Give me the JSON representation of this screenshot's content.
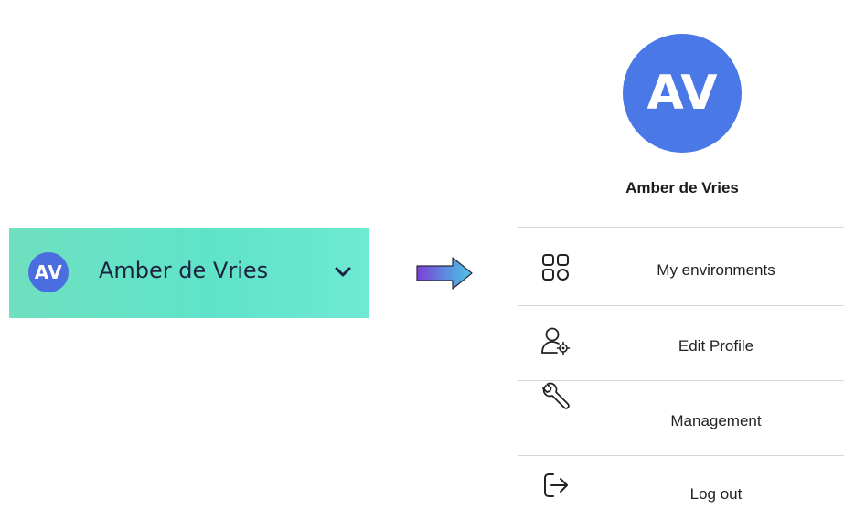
{
  "user": {
    "initials": "AV",
    "name": "Amber de Vries"
  },
  "colors": {
    "chip_background": "#62e2c6",
    "avatar_blue": "#4a78e6",
    "arrow_start": "#7b3fd6",
    "arrow_end": "#4fc6e8"
  },
  "chip": {
    "chevron_icon": "chevron-down-icon"
  },
  "menu": {
    "items": [
      {
        "label": "My environments",
        "icon": "grid-icon"
      },
      {
        "label": "Edit Profile",
        "icon": "user-settings-icon"
      },
      {
        "label": "Management",
        "icon": "wrench-icon"
      },
      {
        "label": "Log out",
        "icon": "logout-icon"
      }
    ]
  }
}
